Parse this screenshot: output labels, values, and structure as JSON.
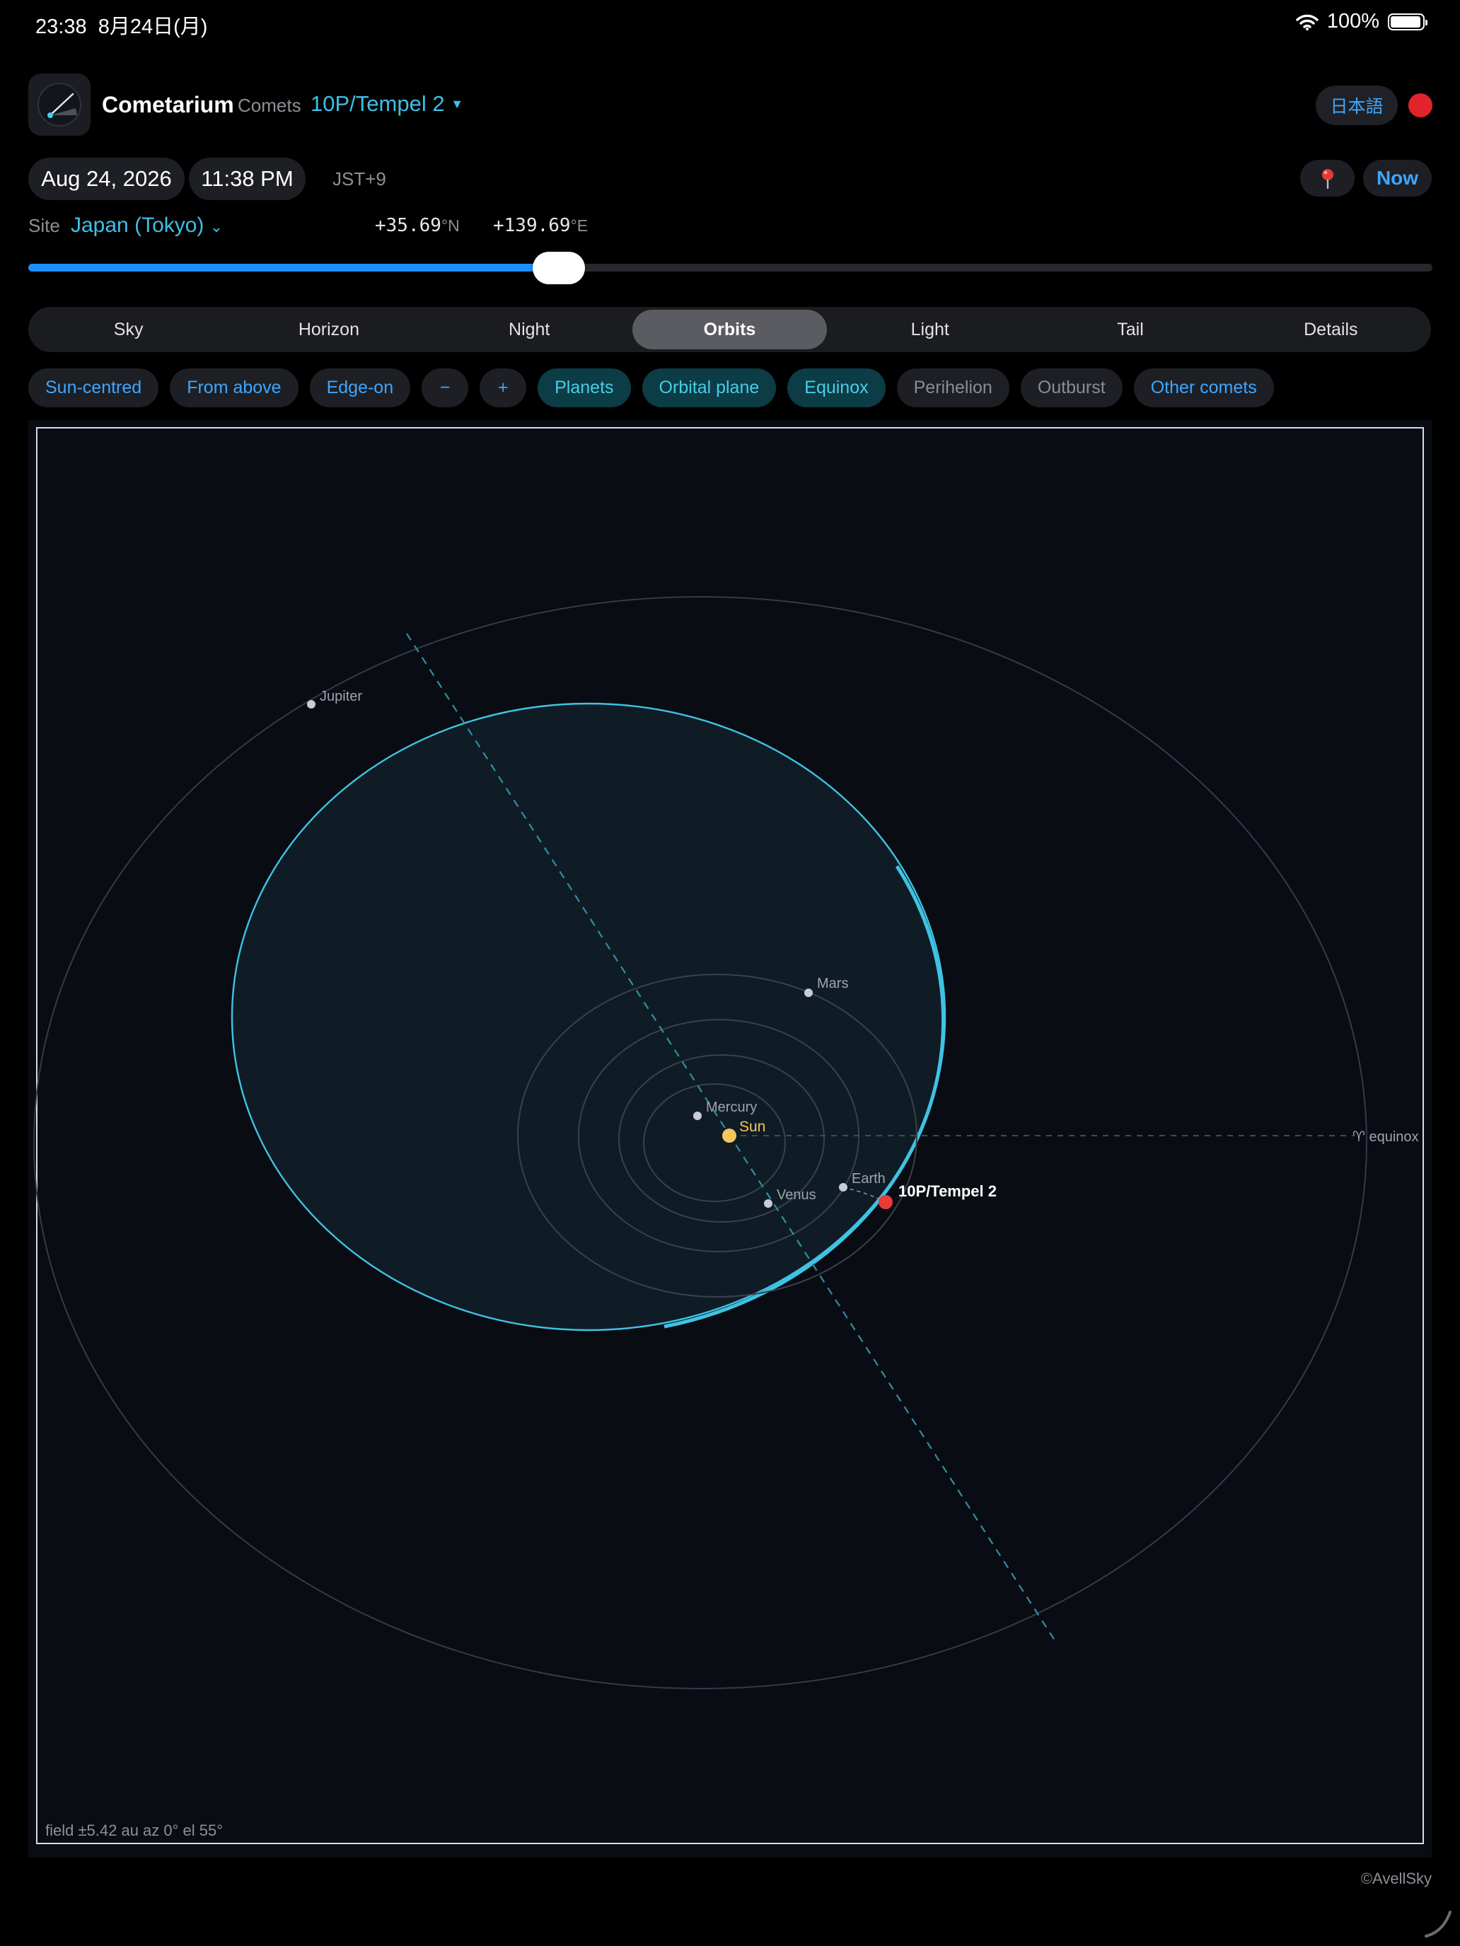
{
  "status_bar": {
    "time": "23:38",
    "date": "8月24日(月)",
    "battery": "100%"
  },
  "header": {
    "app_title": "Cometarium",
    "comets_label": "Comets",
    "comet_select": "10P/Tempel 2",
    "language_button": "日本語"
  },
  "datetime": {
    "date": "Aug 24, 2026",
    "time": "11:38 PM",
    "timezone": "JST+9",
    "now_button": "Now"
  },
  "site": {
    "label": "Site",
    "name": "Japan (Tokyo)",
    "latitude": "+35.69",
    "lat_unit": "°N",
    "longitude": "+139.69",
    "lon_unit": "°E"
  },
  "time_slider": {
    "fraction": 0.378
  },
  "tabs": [
    "Sky",
    "Horizon",
    "Night",
    "Orbits",
    "Light",
    "Tail",
    "Details"
  ],
  "active_tab": "Orbits",
  "toggles": [
    {
      "label": "Sun-centred",
      "state": "action"
    },
    {
      "label": "From above",
      "state": "action"
    },
    {
      "label": "Edge-on",
      "state": "action"
    },
    {
      "label": "−",
      "state": "action"
    },
    {
      "label": "+",
      "state": "action"
    },
    {
      "label": "Planets",
      "state": "on"
    },
    {
      "label": "Orbital plane",
      "state": "on"
    },
    {
      "label": "Equinox",
      "state": "on"
    },
    {
      "label": "Perihelion",
      "state": "off"
    },
    {
      "label": "Outburst",
      "state": "off"
    },
    {
      "label": "Other comets",
      "state": "action"
    }
  ],
  "orbit_view": {
    "sun_label": "Sun",
    "comet_label": "10P/Tempel 2",
    "equinox_label": "♈︎ equinox",
    "planets": [
      "Mercury",
      "Venus",
      "Earth",
      "Mars",
      "Jupiter"
    ],
    "readout": "field ±5.42 au  az 0°  el 55°",
    "colors": {
      "comet_orbit": "#3fc3e3",
      "sun": "#f5c75a",
      "comet": "#ea3b3b",
      "planet": "#c9ccd6"
    }
  },
  "footer": {
    "credit": "©AvellSky"
  }
}
